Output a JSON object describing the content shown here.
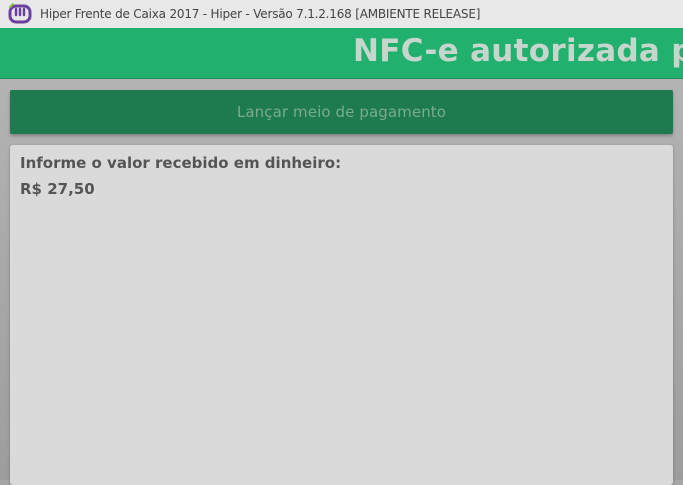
{
  "window": {
    "title": "Hiper Frente de Caixa 2017    -    Hiper - Versão 7.1.2.168 [AMBIENTE RELEASE]",
    "logo_icon": "hiper-logo-icon"
  },
  "banner": {
    "message": "NFC-e autorizada pel"
  },
  "payment": {
    "header_label": "Lançar meio de pagamento",
    "prompt": "Informe o valor recebido em dinheiro:",
    "amount": "R$ 27,50"
  },
  "colors": {
    "banner": "#22b06e",
    "header": "#1e7a4f",
    "logo": "#6b3fa0"
  }
}
